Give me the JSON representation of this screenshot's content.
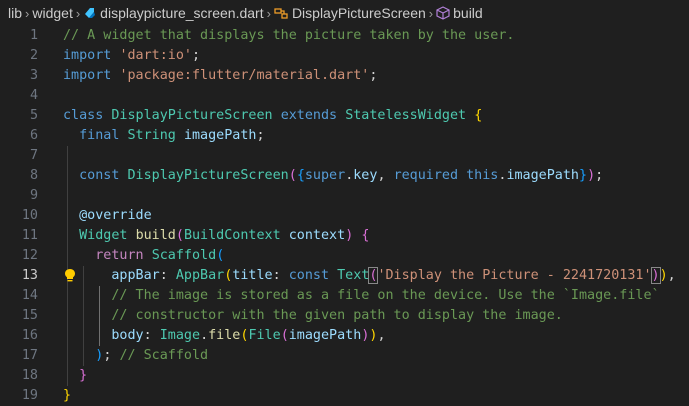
{
  "breadcrumb": {
    "folder1": "lib",
    "folder2": "widget",
    "file": "displaypicture_screen.dart",
    "class": "DisplayPictureScreen",
    "method": "build"
  },
  "code": {
    "line_numbers": [
      "1",
      "2",
      "3",
      "4",
      "5",
      "6",
      "7",
      "8",
      "9",
      "10",
      "11",
      "12",
      "13",
      "14",
      "15",
      "16",
      "17",
      "18",
      "19"
    ],
    "l1": "// A widget that displays the picture taken by the user.",
    "import_kw": "import",
    "import1": "'dart:io'",
    "import2": "'package:flutter/material.dart'",
    "class_kw": "class",
    "class_name": "DisplayPictureScreen",
    "extends_kw": "extends",
    "super_class": "StatelessWidget",
    "final_kw": "final",
    "string_type": "String",
    "image_path": "imagePath",
    "const_kw": "const",
    "super_kw": "super",
    "key": "key",
    "required_kw": "required",
    "this_kw": "this",
    "override": "@override",
    "widget_type": "Widget",
    "build_fn": "build",
    "build_ctx_type": "BuildContext",
    "context_var": "context",
    "return_kw": "return",
    "scaffold": "Scaffold",
    "appbar_prop": "appBar",
    "appbar_class": "AppBar",
    "title_prop": "title",
    "text_class": "Text",
    "title_string": "'Display the Picture - 2241720131'",
    "comment14": "// The image is stored as a file on the device. Use the `Image.file`",
    "comment15": "// constructor with the given path to display the image.",
    "body_prop": "body",
    "image_class": "Image",
    "file_fn": "file",
    "file_class": "File",
    "scaffold_comment": "// Scaffold"
  }
}
